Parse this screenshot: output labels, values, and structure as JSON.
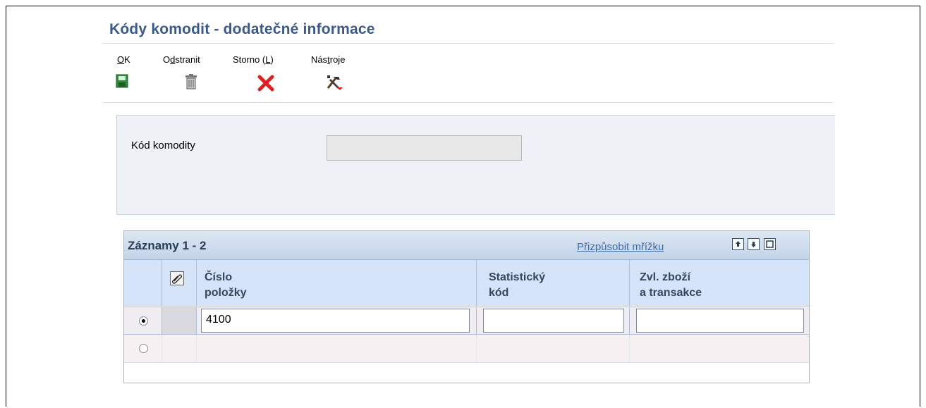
{
  "page": {
    "title": "Kódy komodit - dodatečné informace"
  },
  "toolbar": {
    "ok": {
      "label_ul": "O",
      "label_rest": "K",
      "icon": "save-disk-icon"
    },
    "delete": {
      "label_pre": "O",
      "label_ul": "d",
      "label_rest": "stranit",
      "icon": "trash-icon"
    },
    "cancel": {
      "label_pre": "Storno (",
      "label_ul": "L",
      "label_rest": ")",
      "icon": "red-x-icon"
    },
    "tools": {
      "label_pre": "Nás",
      "label_ul": "t",
      "label_rest": "roje",
      "icon": "tools-icon"
    }
  },
  "form": {
    "commodity_code_label": "Kód komodity",
    "commodity_code_value": ""
  },
  "grid": {
    "title": "Záznamy 1 - 2",
    "customize_link": "Přizpůsobit mřížku",
    "buttons": [
      "export-icon",
      "import-icon",
      "maximize-icon"
    ],
    "columns": [
      {
        "line1": "Číslo",
        "line2": "položky"
      },
      {
        "line1": "Statistický",
        "line2": "kód"
      },
      {
        "line1": "Zvl. zboží",
        "line2": "a transakce"
      }
    ],
    "rows": [
      {
        "selected": true,
        "item_number": "4100",
        "statistical_code": "",
        "special_goods": ""
      },
      {
        "selected": false,
        "item_number": "",
        "statistical_code": "",
        "special_goods": ""
      }
    ]
  },
  "colors": {
    "title": "#3b5a88",
    "grid_header": "#d4e3f7",
    "link": "#3e6aa8"
  }
}
